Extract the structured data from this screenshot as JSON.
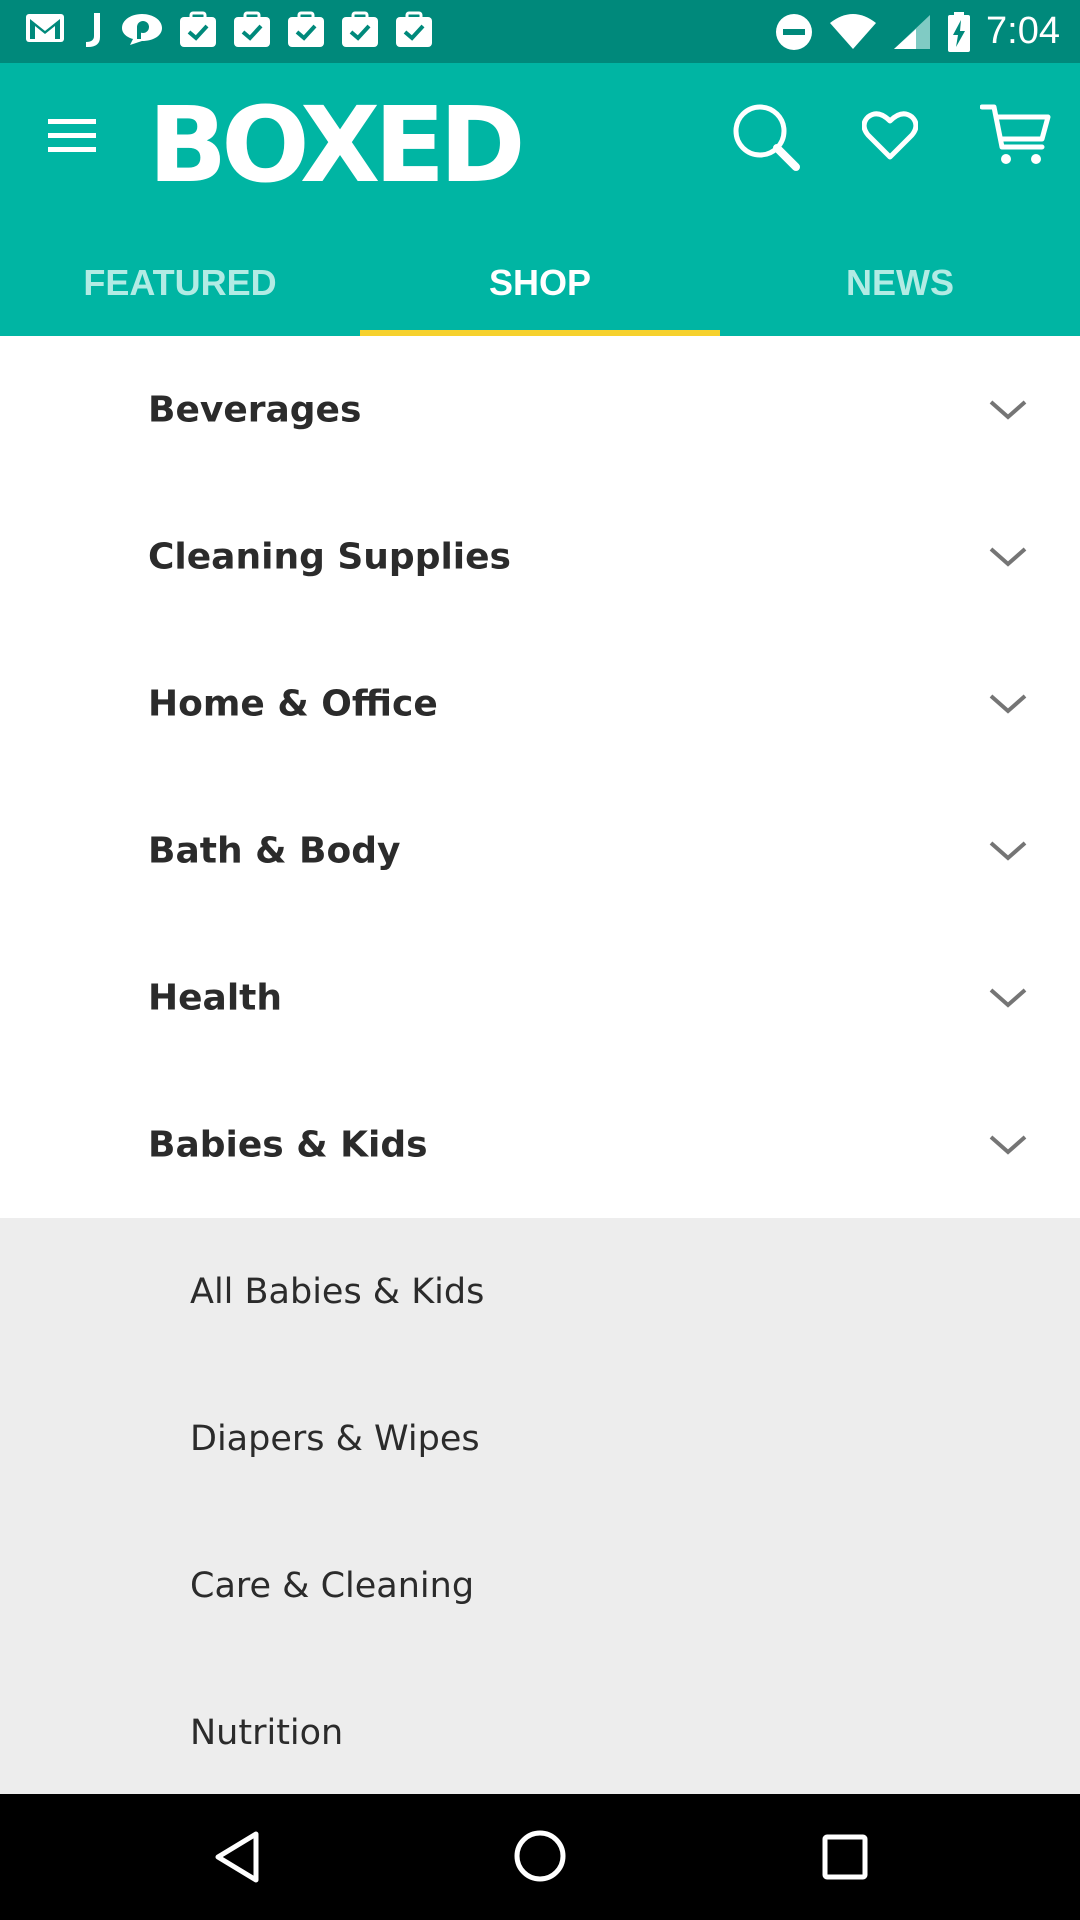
{
  "status_bar": {
    "time": "7:04",
    "left_icons": [
      "gmail-icon",
      "j-app-icon",
      "chat-icon",
      "task-icon",
      "task-icon",
      "task-icon",
      "task-icon",
      "task-icon"
    ],
    "right_icons": [
      "do-not-disturb-icon",
      "wifi-icon",
      "signal-icon",
      "battery-charging-icon"
    ]
  },
  "app_bar": {
    "logo": "BOXED",
    "background": "#00b5a3",
    "icons": [
      "menu-icon",
      "search-icon",
      "heart-icon",
      "cart-icon"
    ]
  },
  "tabs": [
    {
      "label": "FEATURED",
      "active": false
    },
    {
      "label": "SHOP",
      "active": true
    },
    {
      "label": "NEWS",
      "active": false
    }
  ],
  "categories": [
    {
      "label": "Beverages"
    },
    {
      "label": "Cleaning Supplies"
    },
    {
      "label": "Home & Office"
    },
    {
      "label": "Bath & Body"
    },
    {
      "label": "Health"
    },
    {
      "label": "Babies & Kids",
      "expanded": true
    }
  ],
  "subcategories": [
    {
      "label": "All Babies & Kids"
    },
    {
      "label": "Diapers & Wipes"
    },
    {
      "label": "Care & Cleaning"
    },
    {
      "label": "Nutrition"
    }
  ],
  "colors": {
    "accent": "#00b5a3",
    "status_bar": "#00897b",
    "tab_indicator": "#f6d12e",
    "sub_panel": "#ededed"
  }
}
